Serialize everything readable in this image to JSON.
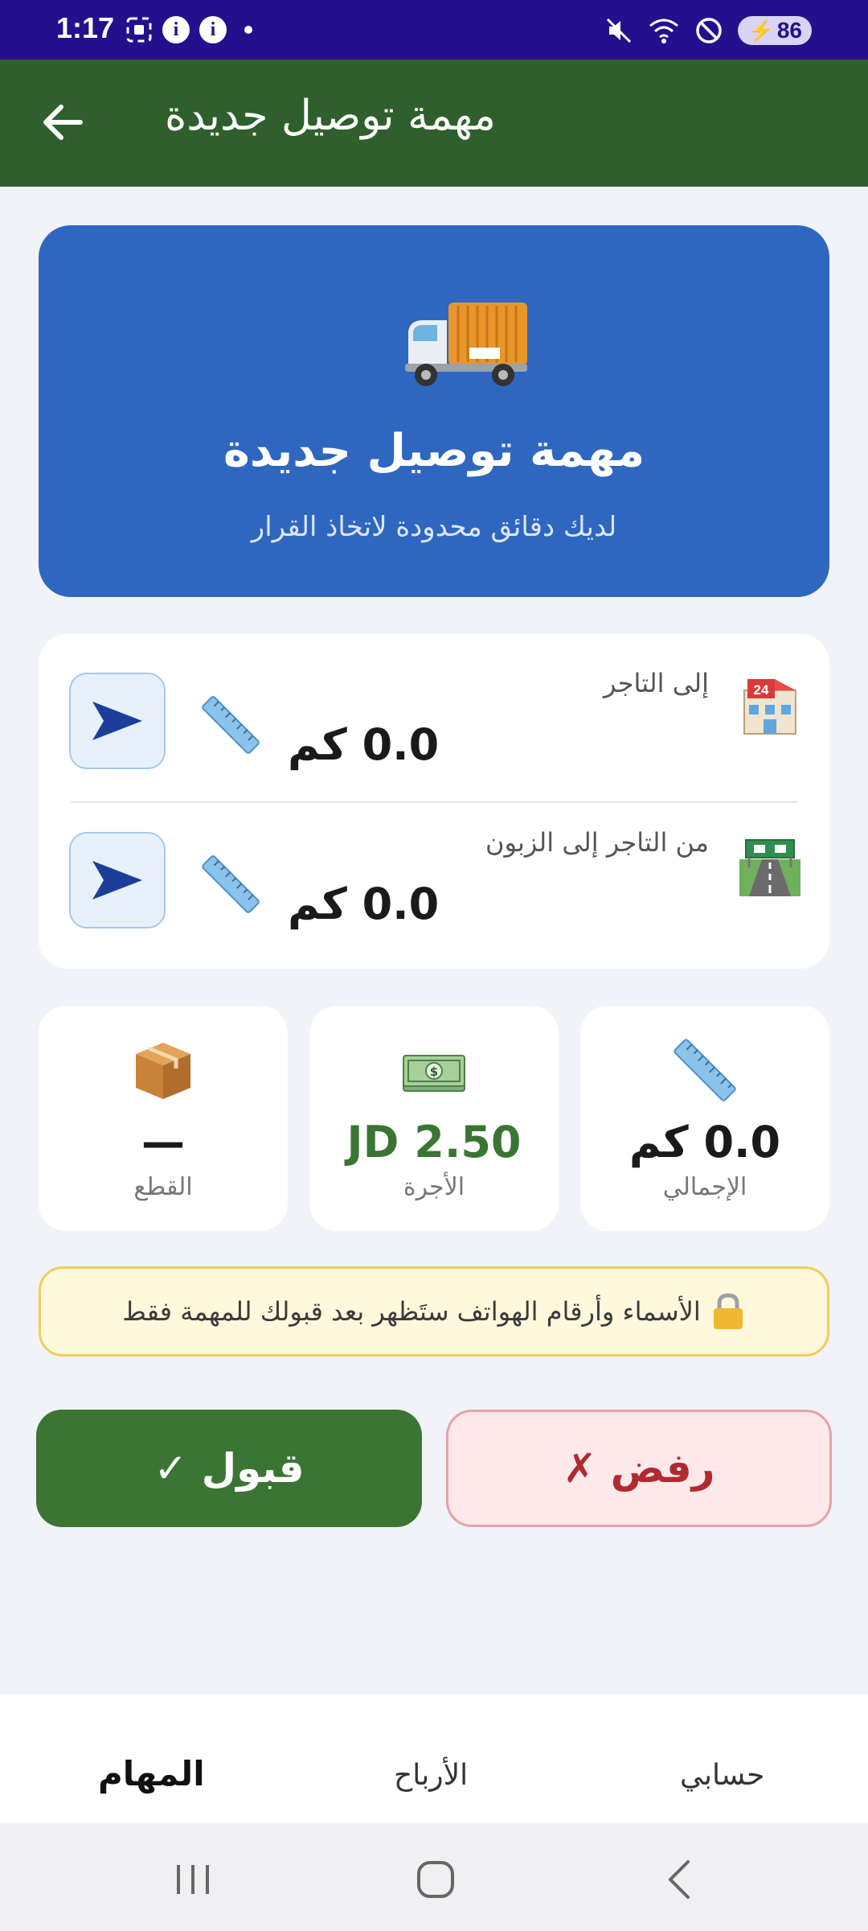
{
  "status_bar": {
    "time": "1:17",
    "battery": "86",
    "icons_left": [
      "screenshot-icon",
      "info-icon",
      "info-icon",
      "dot-icon"
    ],
    "icons_right": [
      "mute-icon",
      "wifi-icon",
      "no-disturb-icon",
      "battery-charging-icon"
    ]
  },
  "app_bar": {
    "title": "مهمة توصيل جديدة",
    "back_icon": "arrow-left-icon"
  },
  "hero": {
    "icon": "delivery-truck-icon",
    "title": "مهمة توصيل جديدة",
    "subtitle": "لديك دقائق محدودة لاتخاذ القرار",
    "background": "#2f66c0"
  },
  "distances": [
    {
      "label": "إلى التاجر",
      "value": "0.0 كم",
      "icon": "store-24-icon"
    },
    {
      "label": "من التاجر إلى الزبون",
      "value": "0.0 كم",
      "icon": "highway-icon"
    }
  ],
  "stats": [
    {
      "label": "الإجمالي",
      "value": "0.0 كم",
      "icon": "ruler-icon"
    },
    {
      "label": "الأجرة",
      "value": "2.50 JD",
      "icon": "money-icon",
      "color": "#3b7533"
    },
    {
      "label": "القطع",
      "value": "—",
      "icon": "package-icon"
    }
  ],
  "notice": {
    "text": "الأسماء وأرقام الهواتف ستَظهر بعد قبولك للمهمة فقط",
    "icon": "lock-icon"
  },
  "actions": {
    "reject": "رفض ✗",
    "accept": "قبول ✓",
    "reject_color": "#b02a30",
    "accept_color": "#3b7533"
  },
  "tabs": [
    {
      "label": "المهام",
      "active": true
    },
    {
      "label": "الأرباح",
      "active": false
    },
    {
      "label": "حسابي",
      "active": false
    }
  ],
  "colors": {
    "status_bar": "#24108c",
    "app_bar": "#2e5f2c"
  }
}
